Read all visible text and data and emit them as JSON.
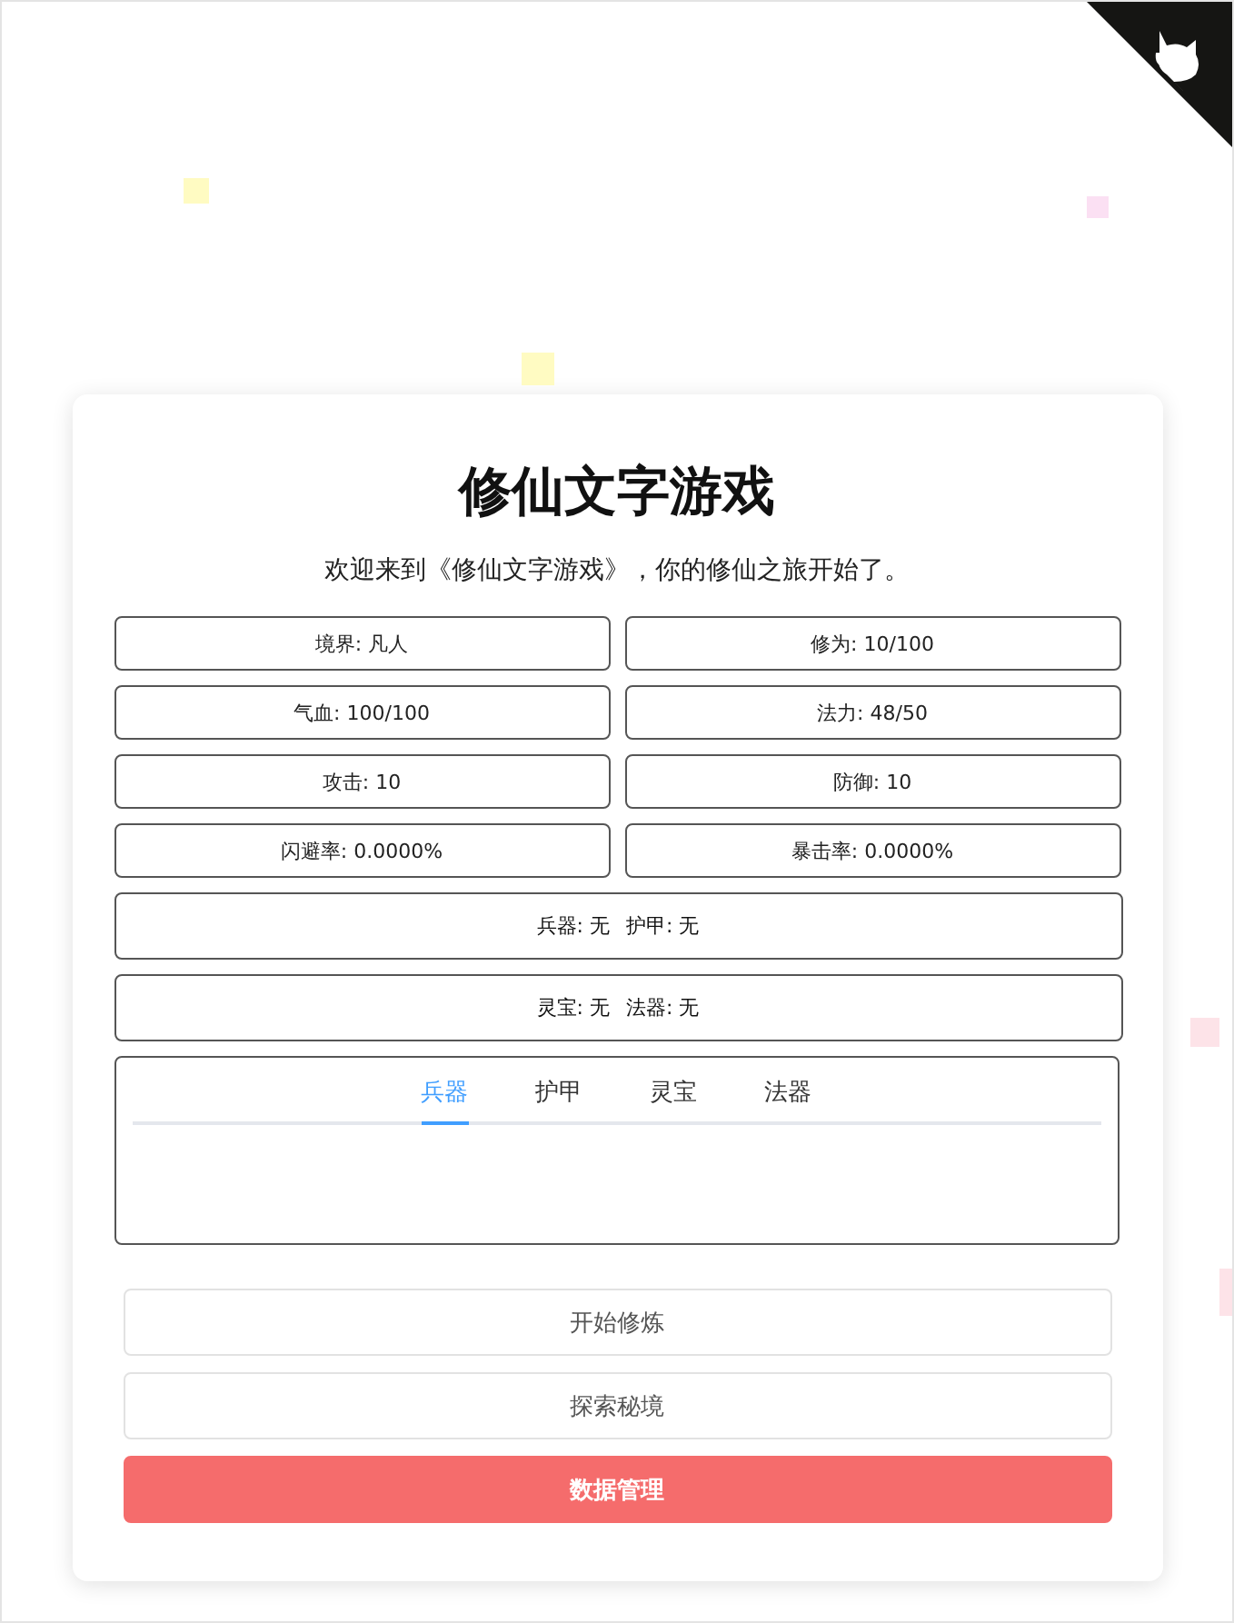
{
  "confetti": [
    {
      "color": "#fffbc2"
    },
    {
      "color": "#fbe0f3"
    },
    {
      "color": "#fffbc2"
    },
    {
      "color": "#fde3e8"
    },
    {
      "color": "#fde3e8"
    }
  ],
  "title": "修仙文字游戏",
  "intro": "欢迎来到《修仙文字游戏》，你的修仙之旅开始了。",
  "stats": [
    "境界: 凡人",
    "修为: 10/100",
    "气血: 100/100",
    "法力: 48/50",
    "攻击: 10",
    "防御: 10",
    "闪避率: 0.0000%",
    "暴击率: 0.0000%"
  ],
  "equipment_rows": [
    [
      "兵器: 无",
      "护甲: 无"
    ],
    [
      "灵宝: 无",
      "法器: 无"
    ]
  ],
  "tabs": [
    {
      "label": "兵器",
      "selected": true
    },
    {
      "label": "护甲",
      "selected": false
    },
    {
      "label": "灵宝",
      "selected": false
    },
    {
      "label": "法器",
      "selected": false
    }
  ],
  "buttons": [
    {
      "label": "开始修炼",
      "kind": "plain"
    },
    {
      "label": "探索秘境",
      "kind": "plain"
    },
    {
      "label": "数据管理",
      "kind": "danger"
    }
  ]
}
